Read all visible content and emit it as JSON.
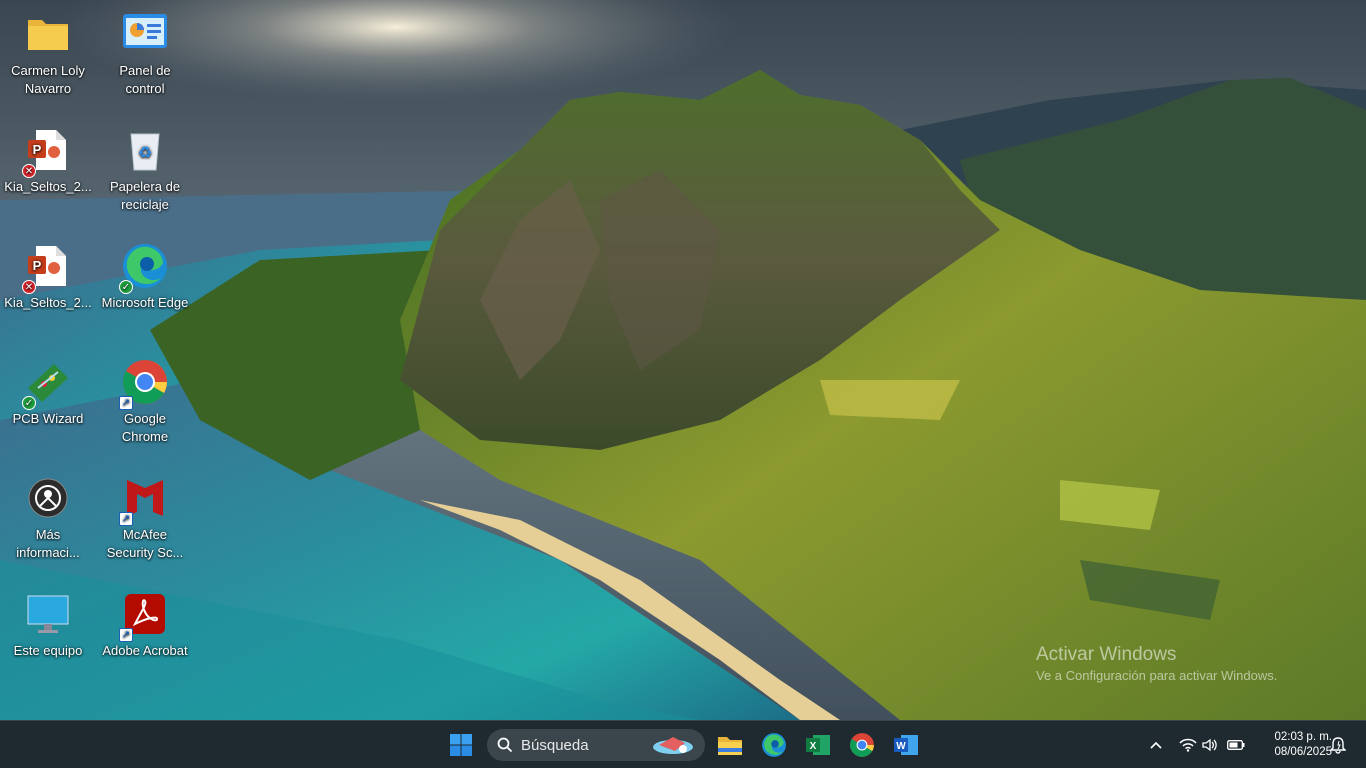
{
  "desktop": {
    "icons": [
      {
        "name": "folder-icon",
        "label": "Carmen Loly\nNavarro"
      },
      {
        "name": "control-panel-icon",
        "label": "Panel de\ncontrol"
      },
      {
        "name": "powerpoint-file-icon",
        "label": "Kia_Seltos_2..."
      },
      {
        "name": "recycle-bin-icon",
        "label": "Papelera de\nreciclaje"
      },
      {
        "name": "powerpoint-file-icon",
        "label": "Kia_Seltos_2..."
      },
      {
        "name": "edge-icon",
        "label": "Microsoft Edge"
      },
      {
        "name": "pcb-wizard-icon",
        "label": "PCB Wizard"
      },
      {
        "name": "chrome-icon",
        "label": "Google\nChrome"
      },
      {
        "name": "more-info-icon",
        "label": "Más\ninformaci..."
      },
      {
        "name": "mcafee-icon",
        "label": "McAfee\nSecurity Sc..."
      },
      {
        "name": "this-pc-icon",
        "label": "Este equipo"
      },
      {
        "name": "adobe-acrobat-icon",
        "label": "Adobe Acrobat"
      }
    ]
  },
  "watermark": {
    "line1": "Activar Windows",
    "line2": "Ve a Configuración para activar Windows."
  },
  "taskbar": {
    "search_placeholder": "Búsqueda",
    "pinned": [
      "file-explorer-icon",
      "edge-icon",
      "excel-icon",
      "chrome-icon",
      "word-icon"
    ],
    "clock_time": "02:03 p. m.",
    "clock_date": "08/06/2025"
  },
  "colors": {
    "taskbar_bg": "#1f2a30",
    "windows_blue": "#2b8ce6",
    "chrome_red": "#db4437",
    "mcafee_red": "#c01818",
    "acrobat_red": "#b30b00"
  }
}
